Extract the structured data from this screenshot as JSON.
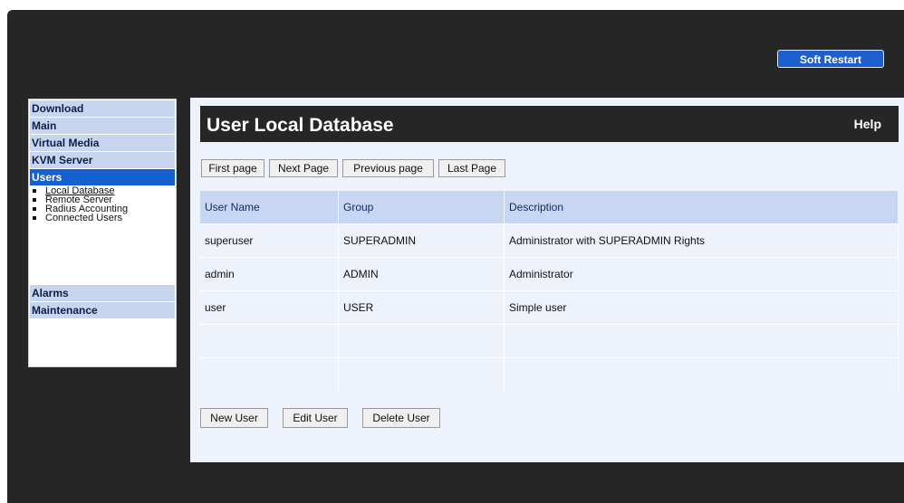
{
  "header": {
    "soft_restart": "Soft Restart"
  },
  "sidebar": {
    "items_top": [
      {
        "label": "Download"
      },
      {
        "label": "Main"
      },
      {
        "label": "Virtual Media"
      },
      {
        "label": "KVM Server"
      }
    ],
    "active": {
      "label": "Users"
    },
    "submenu": [
      {
        "label": "Local Database",
        "selected": true
      },
      {
        "label": "Remote Server"
      },
      {
        "label": "Radius Accounting"
      },
      {
        "label": "Connected Users"
      }
    ],
    "items_bottom": [
      {
        "label": "Alarms"
      },
      {
        "label": "Maintenance"
      }
    ]
  },
  "main": {
    "title": "User Local Database",
    "help": "Help",
    "pager": {
      "first": "First page",
      "next": "Next Page",
      "previous": "Previous page",
      "last": "Last Page"
    },
    "table": {
      "columns": [
        "User Name",
        "Group",
        "Description"
      ],
      "rows": [
        [
          "superuser",
          "SUPERADMIN",
          "Administrator with SUPERADMIN Rights"
        ],
        [
          "admin",
          "ADMIN",
          "Administrator"
        ],
        [
          "user",
          "USER",
          "Simple user"
        ],
        [
          "",
          "",
          ""
        ],
        [
          "",
          "",
          ""
        ]
      ]
    },
    "actions": {
      "new": "New User",
      "edit": "Edit User",
      "delete": "Delete User"
    }
  },
  "colors": {
    "frame_bg": "#262626",
    "panel_bg": "#eef2fb",
    "accent": "#1560d0",
    "table_header": "#c7d6f2"
  }
}
